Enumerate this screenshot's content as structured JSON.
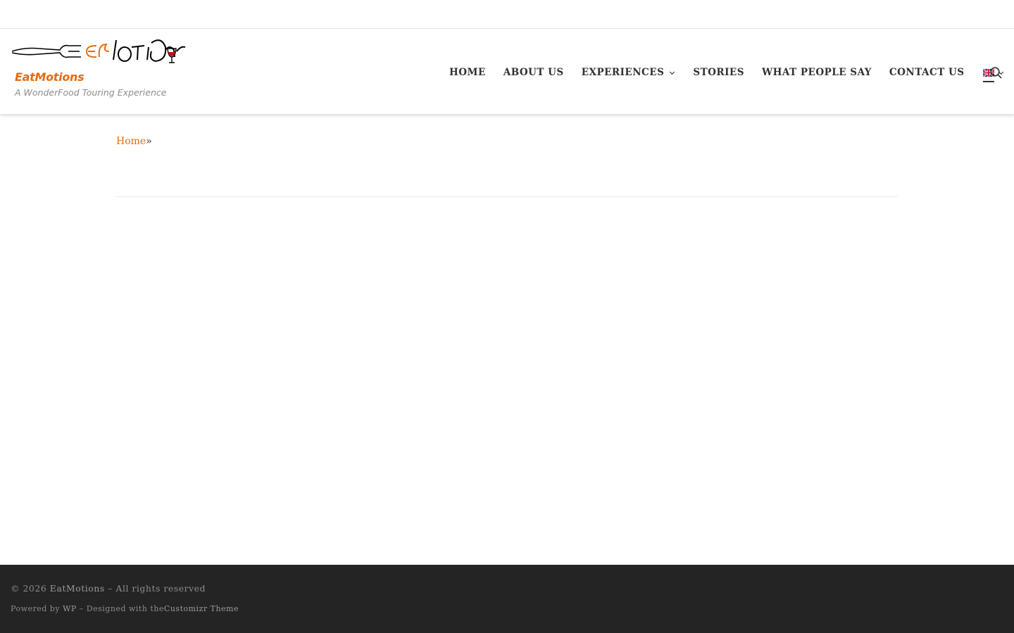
{
  "site": {
    "name": "EatMotions",
    "tagline": "A WonderFood Touring Experience",
    "logo_text": "EatMotions"
  },
  "colors": {
    "accent": "#e96a0c",
    "footer_bg": "#242424",
    "text": "#313131"
  },
  "nav": {
    "items": [
      {
        "label": "HOME"
      },
      {
        "label": "ABOUT US"
      },
      {
        "label": "EXPERIENCES",
        "has_dropdown": true
      },
      {
        "label": "STORIES"
      },
      {
        "label": "WHAT PEOPLE SAY"
      },
      {
        "label": "CONTACT US"
      }
    ],
    "language_icon": "uk-flag-icon",
    "search_icon": "search-icon"
  },
  "breadcrumb": {
    "home_label": "Home",
    "separator": "»"
  },
  "footer": {
    "copyright_prefix": "© 2026",
    "site_link": "EatMotions",
    "rights": "– All rights reserved",
    "powered_prefix": "Powered by",
    "wp_link": "WP",
    "designed_text": "– Designed with the",
    "theme_link": "Customizr Theme"
  }
}
